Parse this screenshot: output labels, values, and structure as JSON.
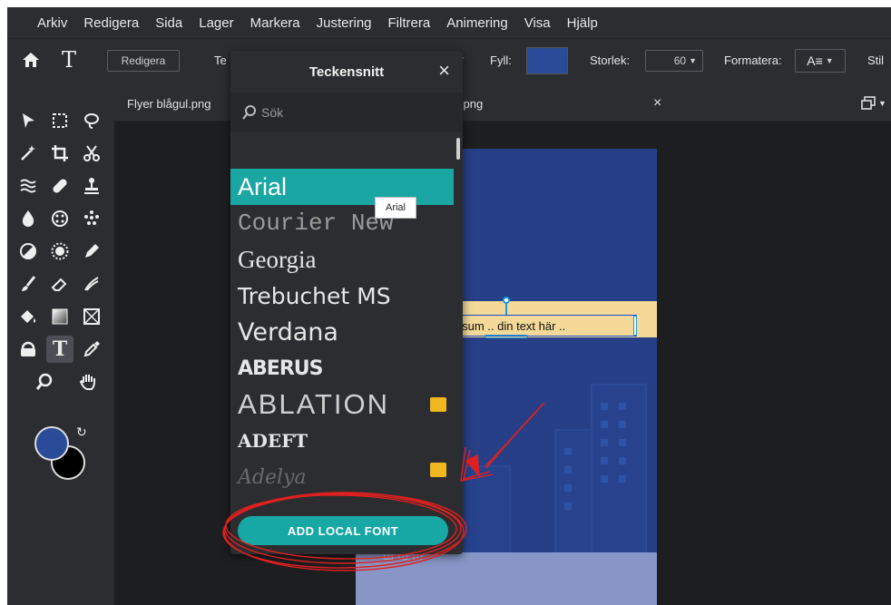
{
  "menu": [
    "Arkiv",
    "Redigera",
    "Sida",
    "Lager",
    "Markera",
    "Justering",
    "Filtrera",
    "Animering",
    "Visa",
    "Hjälp"
  ],
  "toolbar": {
    "edit_label": "Redigera",
    "t_partial": "Te",
    "fill_label": "Fyll:",
    "fill_color": "#2a4c98",
    "size_label": "Storlek:",
    "size_value": "60",
    "format_label": "Formatera:",
    "style_label": "Stil"
  },
  "tabs": [
    {
      "label": "Flyer blågul.png"
    },
    {
      "label": "l.png"
    }
  ],
  "font_panel": {
    "title": "Teckensnitt",
    "search_placeholder": "Sök",
    "fonts": [
      {
        "name": "Arial",
        "selected": true
      },
      {
        "name": "Courier New"
      },
      {
        "name": "Georgia"
      },
      {
        "name": "Trebuchet MS"
      },
      {
        "name": "Verdana"
      },
      {
        "name": "ABERUS"
      },
      {
        "name": "ABLATION",
        "premium": true
      },
      {
        "name": "ADEFT"
      },
      {
        "name": "Adelya",
        "premium": true
      }
    ],
    "add_button": "ADD LOCAL FONT",
    "tooltip": "Arial"
  },
  "canvas": {
    "text_box": "ipsum .. din text här ..",
    "doc_bg": "#273f86",
    "band_color": "#f4d998",
    "bottom_color": "#8796c6"
  },
  "colors": {
    "accent": "#17a7a4",
    "foreground": "#2a4c98",
    "background": "#000000",
    "annotation": "#e02020"
  }
}
